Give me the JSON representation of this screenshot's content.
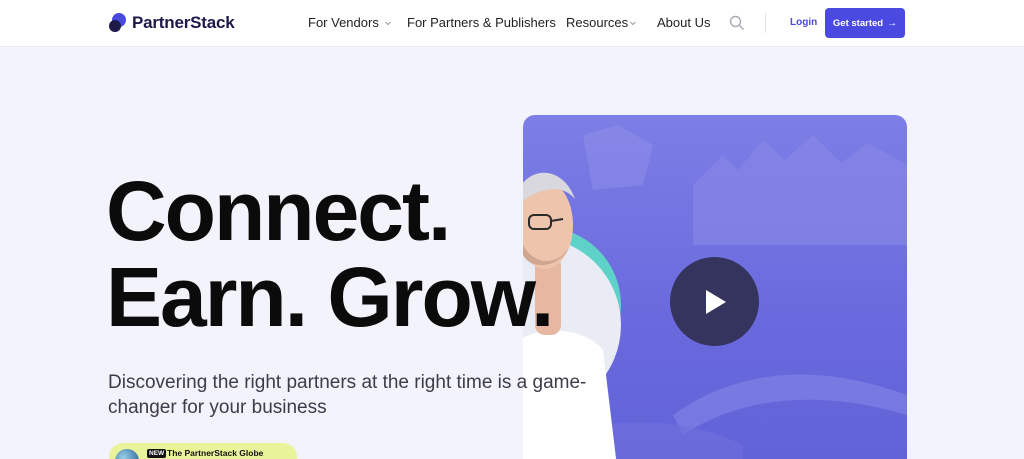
{
  "brand": {
    "name": "PartnerStack"
  },
  "nav": {
    "items": [
      {
        "label": "For Vendors",
        "has_dropdown": true
      },
      {
        "label": "For Partners & Publishers",
        "has_dropdown": false
      },
      {
        "label": "Resources",
        "has_dropdown": true
      },
      {
        "label": "About Us",
        "has_dropdown": false
      }
    ],
    "login_label": "Login",
    "cta_label": "Get started"
  },
  "hero": {
    "headline_line1": "Connect.",
    "headline_line2": "Earn. Grow.",
    "subtext": "Discovering the right partners at the right time is a game-changer for your business",
    "pill_badge": "NEW",
    "pill_text": "The PartnerStack Globe"
  },
  "colors": {
    "accent": "#4a4ae0",
    "background": "#f3f3fb",
    "video_purple": "#6a6ade",
    "teal": "#5ed2c8",
    "pill_yellow": "#e8f39a",
    "play_button": "#34345f"
  },
  "icons": {
    "search": "search-icon",
    "play": "play-icon",
    "caret": "chevron-down-icon",
    "arrow": "arrow-right-icon"
  }
}
